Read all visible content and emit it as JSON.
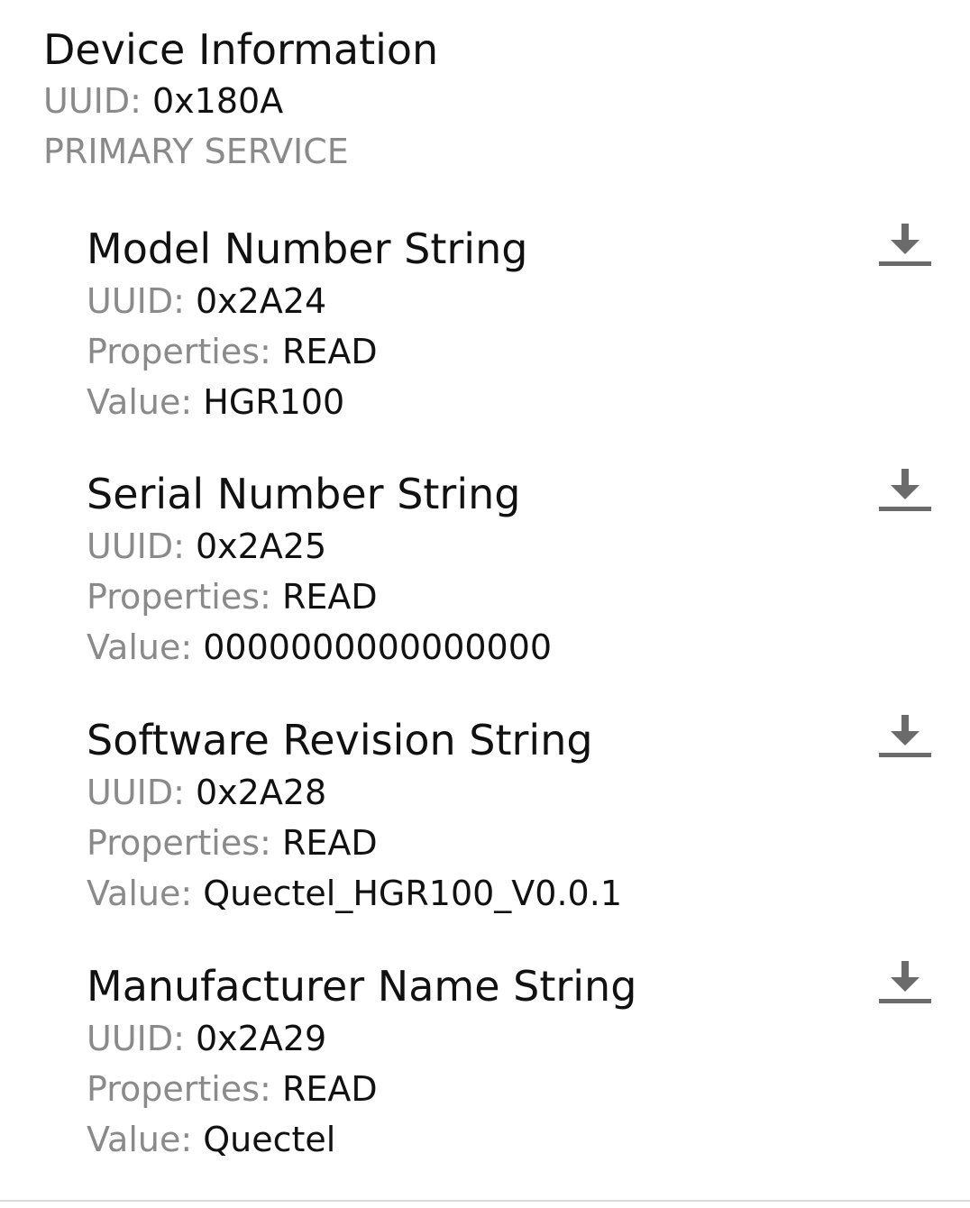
{
  "service": {
    "name": "Device Information",
    "uuid_label": "UUID:",
    "uuid": "0x180A",
    "type": "PRIMARY SERVICE"
  },
  "labels": {
    "uuid": "UUID:",
    "properties": "Properties:",
    "value": "Value:"
  },
  "characteristics": [
    {
      "name": "Model Number String",
      "uuid": "0x2A24",
      "properties": "READ",
      "value": "HGR100",
      "action_icon": "download-icon"
    },
    {
      "name": "Serial Number String",
      "uuid": "0x2A25",
      "properties": "READ",
      "value": "0000000000000000",
      "action_icon": "download-icon"
    },
    {
      "name": "Software Revision String",
      "uuid": "0x2A28",
      "properties": "READ",
      "value": "Quectel_HGR100_V0.0.1",
      "action_icon": "download-icon"
    },
    {
      "name": "Manufacturer Name String",
      "uuid": "0x2A29",
      "properties": "READ",
      "value": "Quectel",
      "action_icon": "download-icon"
    }
  ],
  "colors": {
    "primary_text": "#111111",
    "secondary_text": "#8a8a8a",
    "icon": "#6b6b6b",
    "background": "#ffffff"
  }
}
